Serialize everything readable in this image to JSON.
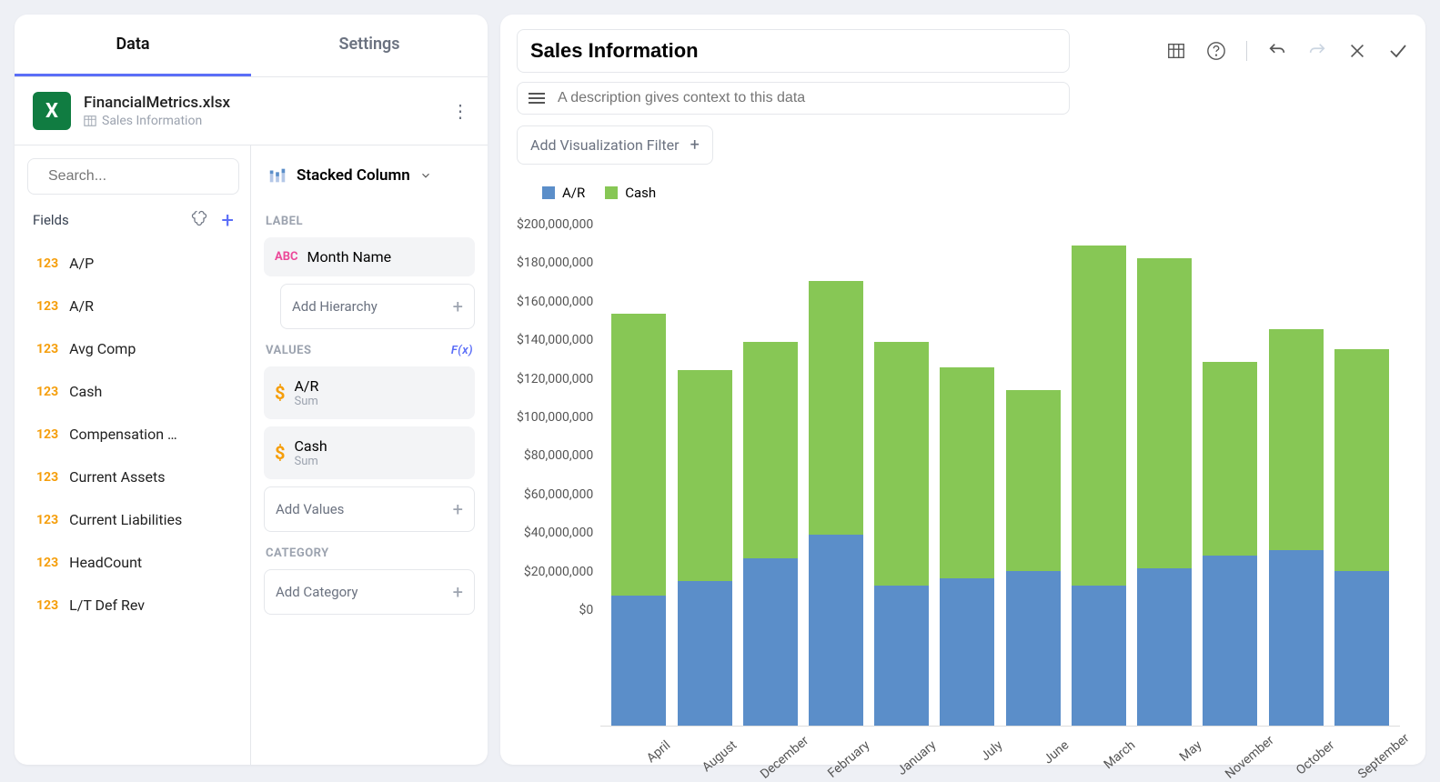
{
  "tabs": {
    "data": "Data",
    "settings": "Settings"
  },
  "datasource": {
    "name": "FinancialMetrics.xlsx",
    "sub": "Sales Information"
  },
  "search_placeholder": "Search...",
  "fields_label": "Fields",
  "fields": [
    {
      "type": "123",
      "name": "A/P"
    },
    {
      "type": "123",
      "name": "A/R"
    },
    {
      "type": "123",
      "name": "Avg Comp"
    },
    {
      "type": "123",
      "name": "Cash"
    },
    {
      "type": "123",
      "name": "Compensation …"
    },
    {
      "type": "123",
      "name": "Current Assets"
    },
    {
      "type": "123",
      "name": "Current Liabilities"
    },
    {
      "type": "123",
      "name": "HeadCount"
    },
    {
      "type": "123",
      "name": "L/T Def Rev"
    }
  ],
  "viz_type": "Stacked Column",
  "sections": {
    "label": "LABEL",
    "values": "VALUES",
    "category": "CATEGORY",
    "fx": "F(x)"
  },
  "label_pill": "Month Name",
  "add_hierarchy": "Add Hierarchy",
  "add_values": "Add Values",
  "add_category": "Add Category",
  "value_pills": [
    {
      "name": "A/R",
      "agg": "Sum"
    },
    {
      "name": "Cash",
      "agg": "Sum"
    }
  ],
  "title": "Sales Information",
  "desc_placeholder": "A description gives context to this data",
  "add_filter": "Add Visualization Filter",
  "legend": [
    {
      "name": "A/R",
      "color": "#5b8ec9"
    },
    {
      "name": "Cash",
      "color": "#87c755"
    }
  ],
  "chart_data": {
    "type": "bar",
    "stacked": true,
    "ylabel": "",
    "xlabel": "",
    "ylim": [
      0,
      200000000
    ],
    "ytick_labels": [
      "$0",
      "$20,000,000",
      "$40,000,000",
      "$60,000,000",
      "$80,000,000",
      "$100,000,000",
      "$120,000,000",
      "$140,000,000",
      "$160,000,000",
      "$180,000,000",
      "$200,000,000"
    ],
    "categories": [
      "April",
      "August",
      "December",
      "February",
      "January",
      "July",
      "June",
      "March",
      "May",
      "November",
      "October",
      "September"
    ],
    "series": [
      {
        "name": "A/R",
        "color": "#5b8ec9",
        "values": [
          51000000,
          57000000,
          66000000,
          75000000,
          55000000,
          58000000,
          61000000,
          55000000,
          62000000,
          67000000,
          69000000,
          61000000
        ]
      },
      {
        "name": "Cash",
        "color": "#87c755",
        "values": [
          111000000,
          83000000,
          85000000,
          100000000,
          96000000,
          83000000,
          71000000,
          134000000,
          122000000,
          76000000,
          87000000,
          87000000
        ]
      }
    ]
  }
}
